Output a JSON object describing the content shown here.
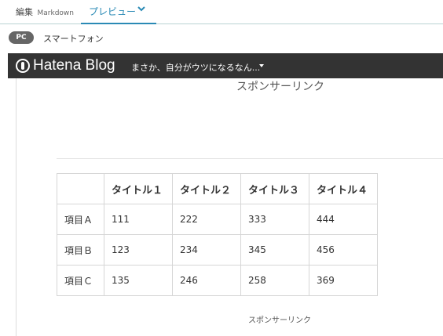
{
  "editor_tabs": {
    "edit_label": "編集",
    "edit_mode": "Markdown",
    "preview_label": "プレビュー"
  },
  "device_toggle": {
    "pc": "PC",
    "smartphone": "スマートフォン"
  },
  "blog": {
    "logo_text": "Hatena Blog",
    "blog_name": "まさか、自分がウツになるなん...",
    "sponsor_top": "スポンサーリンク",
    "sponsor_bottom": "スポンサーリンク"
  },
  "table": {
    "headers": [
      "",
      "タイトル１",
      "タイトル２",
      "タイトル３",
      "タイトル４"
    ],
    "rows": [
      {
        "label": "項目Ａ",
        "cells": [
          "111",
          "222",
          "333",
          "444"
        ]
      },
      {
        "label": "項目Ｂ",
        "cells": [
          "123",
          "234",
          "345",
          "456"
        ]
      },
      {
        "label": "項目Ｃ",
        "cells": [
          "135",
          "246",
          "258",
          "369"
        ]
      }
    ]
  },
  "colors": {
    "accent": "#2a8ab5",
    "blog_bar": "#333333",
    "pill": "#666666"
  }
}
